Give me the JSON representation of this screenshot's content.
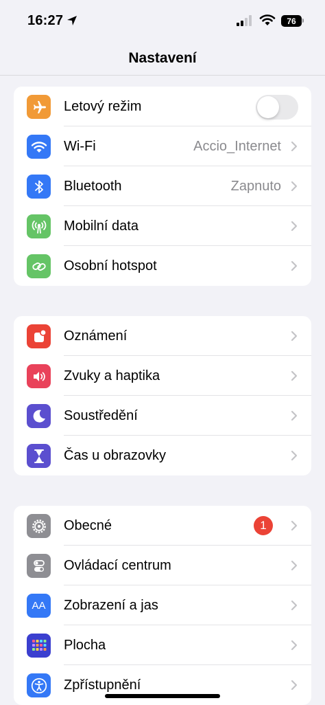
{
  "status": {
    "time": "16:27",
    "battery": "76"
  },
  "nav": {
    "title": "Nastavení"
  },
  "group1": [
    {
      "label": "Letový režim",
      "icon": "airplane-icon",
      "color": "#f19a37",
      "toggle": "off"
    },
    {
      "label": "Wi-Fi",
      "value": "Accio_Internet",
      "icon": "wifi-icon",
      "color": "#3478f6"
    },
    {
      "label": "Bluetooth",
      "value": "Zapnuto",
      "icon": "bluetooth-icon",
      "color": "#3478f6"
    },
    {
      "label": "Mobilní data",
      "icon": "antenna-icon",
      "color": "#65c466"
    },
    {
      "label": "Osobní hotspot",
      "icon": "hotspot-icon",
      "color": "#65c466"
    }
  ],
  "group2": [
    {
      "label": "Oznámení",
      "icon": "bell-icon",
      "color": "#eb4336"
    },
    {
      "label": "Zvuky a haptika",
      "icon": "speaker-icon",
      "color": "#e9425a"
    },
    {
      "label": "Soustředění",
      "icon": "moon-icon",
      "color": "#5b4fcf"
    },
    {
      "label": "Čas u obrazovky",
      "icon": "hourglass-icon",
      "color": "#5b4fcf"
    }
  ],
  "group3": [
    {
      "label": "Obecné",
      "icon": "gear-icon",
      "color": "#8e8e93",
      "badge": "1"
    },
    {
      "label": "Ovládací centrum",
      "icon": "switches-icon",
      "color": "#8e8e93"
    },
    {
      "label": "Zobrazení a jas",
      "icon": "aa-icon",
      "color": "#3478f6",
      "icon_text": "AA"
    },
    {
      "label": "Plocha",
      "icon": "home-screen-icon",
      "color": "#3b3fcf"
    },
    {
      "label": "Zpřístupnění",
      "icon": "accessibility-icon",
      "color": "#3478f6"
    }
  ]
}
